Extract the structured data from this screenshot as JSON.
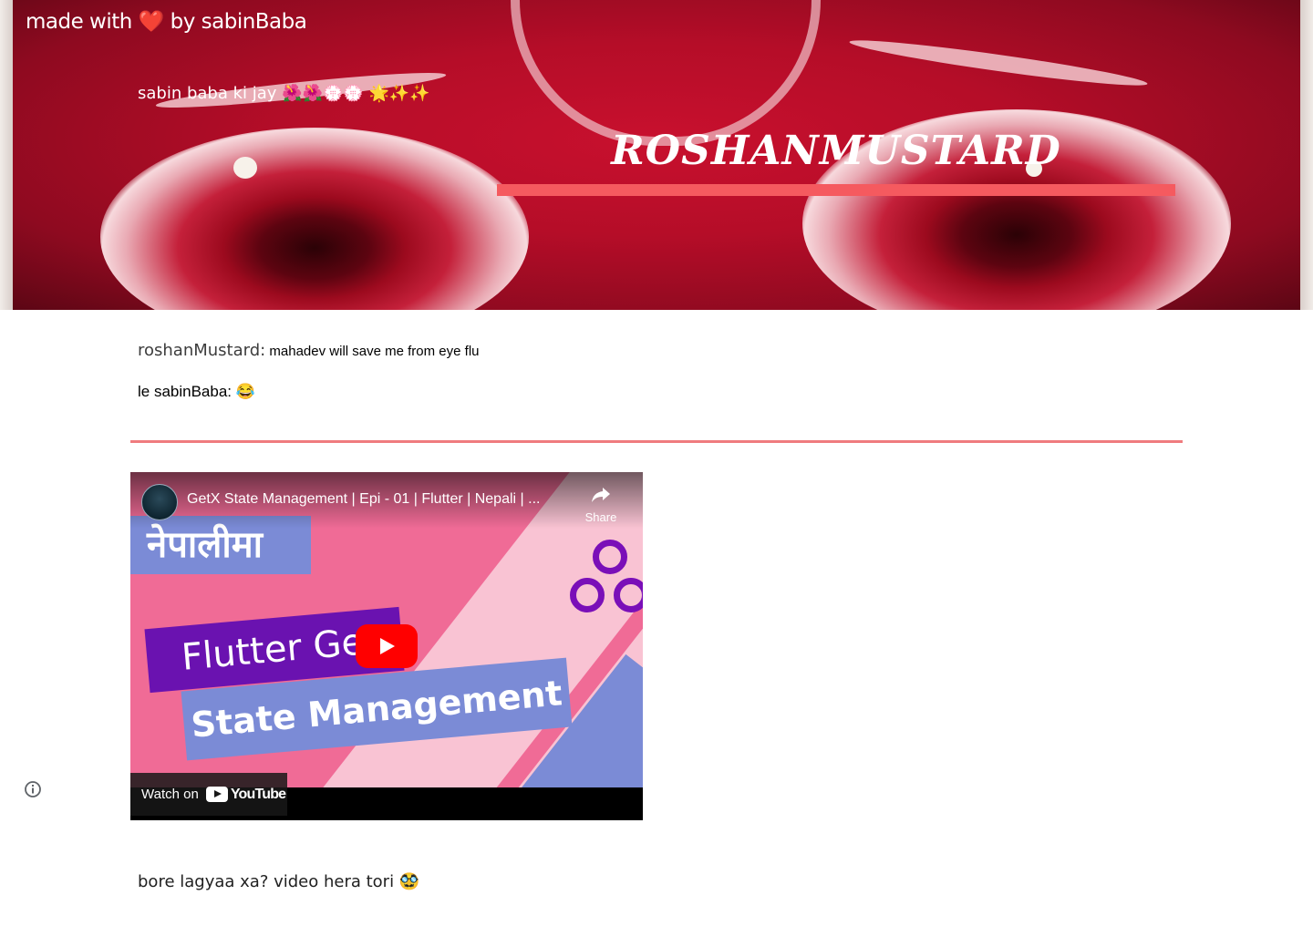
{
  "header": {
    "made_with": "made with ❤️ by sabinBaba",
    "tagline": "sabin baba ki jay 🌺🌺💮💮 🌟✨✨",
    "site_title": "ROSHANMUSTARD"
  },
  "content": {
    "line1_speaker": "roshanMustard:",
    "line1_message": " mahadev will save me from eye flu",
    "line2": "le sabinBaba: 😂",
    "line3": "bore lagyaa xa? video hera tori 🥸"
  },
  "video": {
    "title": "GetX State Management | Epi - 01 | Flutter | Nepali | ...",
    "share_label": "Share",
    "thumbnail_tag": "नेपालीमा",
    "thumbnail_line1": "Flutter Get",
    "thumbnail_line2": "State Management",
    "watch_on_label": "Watch on",
    "youtube_word": "YouTube",
    "play_icon": "play-icon",
    "share_icon": "share-icon"
  },
  "footer": {
    "info_icon": "info-icon"
  },
  "colors": {
    "title_bar": "#f55a5f",
    "divider": "#ef7b7e",
    "play_button": "#ff0000"
  }
}
